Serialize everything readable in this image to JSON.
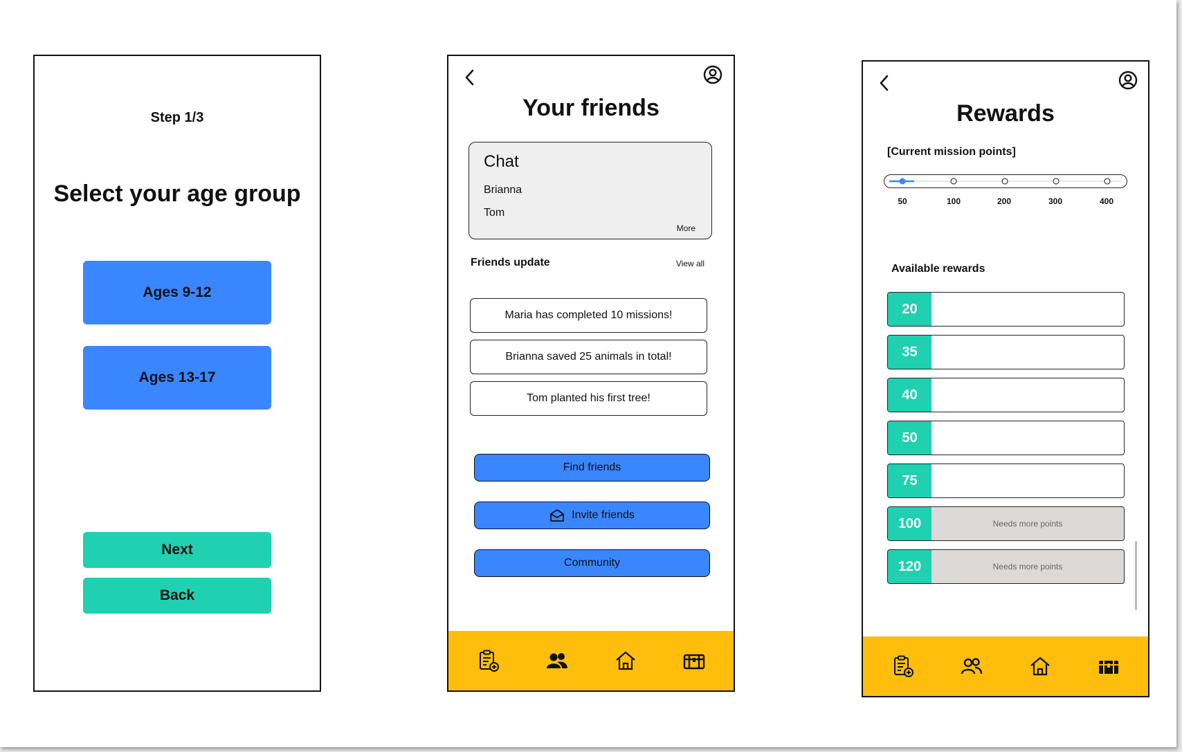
{
  "screen1": {
    "step": "Step 1/3",
    "heading": "Select your age group",
    "age_options": [
      "Ages 9-12",
      "Ages 13-17"
    ],
    "next": "Next",
    "back": "Back"
  },
  "screen2": {
    "title": "Your friends",
    "chat": {
      "title": "Chat",
      "names": [
        "Brianna",
        "Tom"
      ],
      "more": "More"
    },
    "updates_label": "Friends update",
    "view_all": "View all",
    "updates": [
      {
        "name": "Maria",
        "text": " has completed 10 missions!"
      },
      {
        "name": "Brianna",
        "text": " saved 25 animals in total!"
      },
      {
        "name": "Tom",
        "text": " planted his first tree!"
      }
    ],
    "buttons": {
      "find": "Find friends",
      "invite": "Invite friends",
      "community": "Community"
    }
  },
  "screen3": {
    "title": "Rewards",
    "points_label": "[Current mission points]",
    "slider_ticks": [
      "50",
      "100",
      "200",
      "300",
      "400"
    ],
    "slider_value": "50",
    "rewards_label": "Available rewards",
    "rewards": [
      {
        "points": "20",
        "note": ""
      },
      {
        "points": "35",
        "note": ""
      },
      {
        "points": "40",
        "note": ""
      },
      {
        "points": "50",
        "note": ""
      },
      {
        "points": "75",
        "note": ""
      },
      {
        "points": "100",
        "note": "Needs more points"
      },
      {
        "points": "120",
        "note": "Needs more points"
      }
    ]
  },
  "tabbar": [
    "missions-icon",
    "friends-icon",
    "home-icon",
    "rewards-chest-icon"
  ],
  "colors": {
    "primary_blue": "#3a86ff",
    "teal": "#1fd1b0",
    "tab_yellow": "#ffbe0b",
    "locked_gray": "#dcdad9"
  }
}
